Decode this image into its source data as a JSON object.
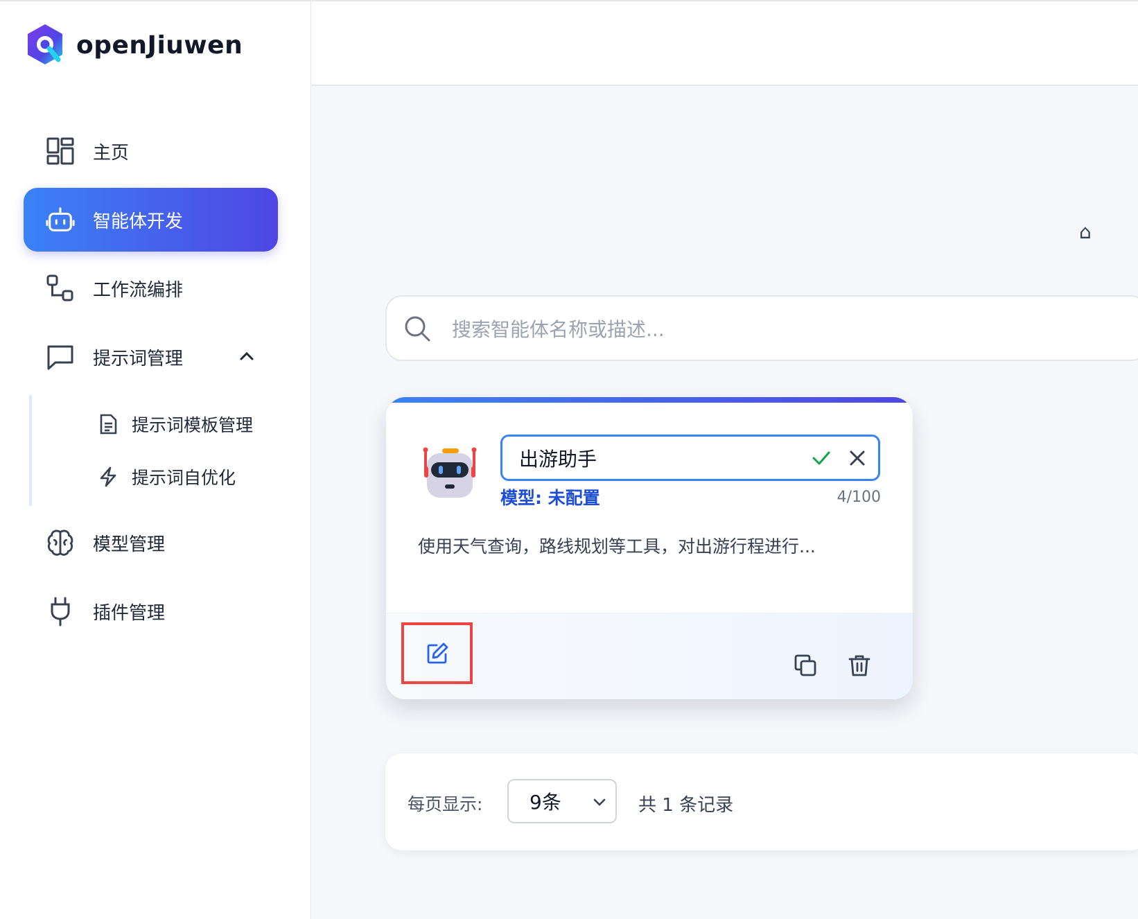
{
  "brand": {
    "name": "openJiuwen"
  },
  "nav": {
    "home": "主页",
    "agent_dev": "智能体开发",
    "workflow": "工作流编排",
    "prompt_mgmt": "提示词管理",
    "prompt_template": "提示词模板管理",
    "prompt_optimize": "提示词自优化",
    "model_mgmt": "模型管理",
    "plugin_mgmt": "插件管理"
  },
  "topbar": {
    "edge_glyph": "⌂"
  },
  "search": {
    "placeholder": "搜索智能体名称或描述..."
  },
  "card": {
    "name_value": "出游助手",
    "model_label": "模型: 未配置",
    "counter": "4/100",
    "description": "使用天气查询，路线规划等工具，对出游行程进行...",
    "icons": [
      "robot-avatar",
      "check-icon",
      "close-icon",
      "edit-icon",
      "copy-icon",
      "trash-icon"
    ]
  },
  "pagination": {
    "per_page_label": "每页显示:",
    "per_page_value": "9条",
    "total_label": "共 1 条记录"
  },
  "colors": {
    "accent": "#3b82f6",
    "accent_end": "#4f46e5",
    "highlight_border": "#ef4444",
    "success": "#16a34a"
  }
}
